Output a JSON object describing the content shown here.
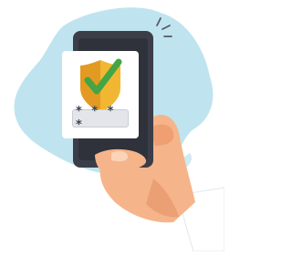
{
  "illustration": {
    "pin_mask": "* * * *",
    "icons": {
      "shield": "shield-icon",
      "checkmark": "checkmark-icon",
      "notification": "notification-burst-icon"
    },
    "colors": {
      "blob": "#bfe4ef",
      "phone_body": "#3b3e48",
      "phone_screen": "#ffffff",
      "shield_gold": "#f2b732",
      "shield_shade": "#e29a22",
      "checkmark": "#43a544",
      "pin_field": "#e3e5ea",
      "hand_skin": "#f6b48a",
      "hand_shadow": "#e28e62",
      "sleeve": "#ffffff"
    }
  }
}
